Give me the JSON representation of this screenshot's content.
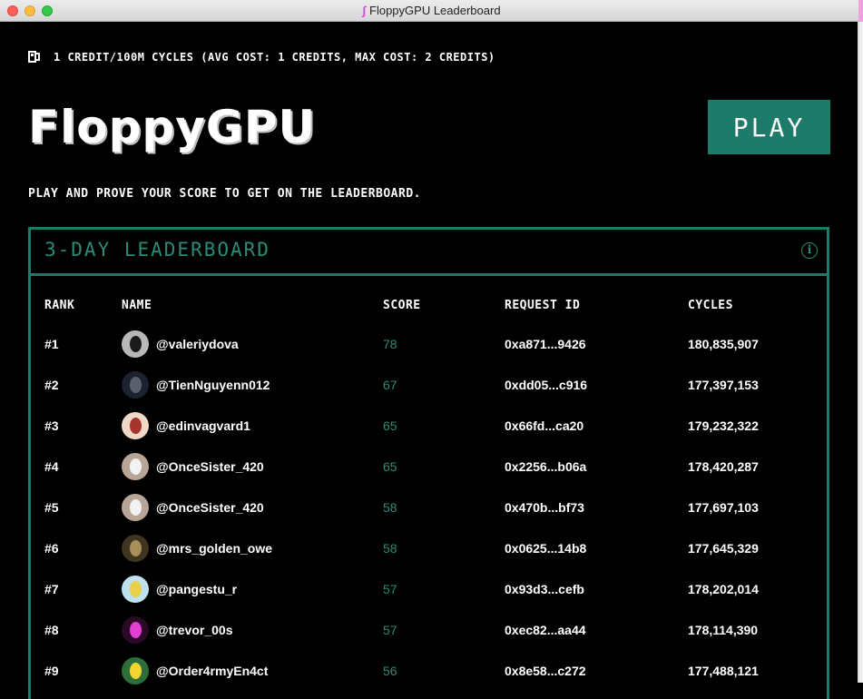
{
  "window": {
    "title": "FloppyGPU Leaderboard"
  },
  "cost": {
    "icon": "fuel-pump-icon",
    "text": "1 credit/100M cycles (avg cost: 1 credits, max cost: 2 credits)"
  },
  "hero": {
    "logo_text": "FloppyGPU",
    "play_label": "PLAY",
    "tagline": "Play and prove your score to get on the leaderboard."
  },
  "leaderboard": {
    "title": "3-Day Leaderboard",
    "info_icon": "info-icon",
    "columns": {
      "rank": "Rank",
      "name": "Name",
      "score": "Score",
      "request_id": "Request ID",
      "cycles": "Cycles"
    },
    "rows": [
      {
        "rank": "#1",
        "name": "@valeriydova",
        "score": "78",
        "request_id": "0xa871...9426",
        "cycles": "180,835,907",
        "avatar": {
          "bg": "#b8b8b8",
          "fg": "#1a1a1a"
        }
      },
      {
        "rank": "#2",
        "name": "@TienNguyenn012",
        "score": "67",
        "request_id": "0xdd05...c916",
        "cycles": "177,397,153",
        "avatar": {
          "bg": "#1d2230",
          "fg": "#5a6070"
        }
      },
      {
        "rank": "#3",
        "name": "@edinvagvard1",
        "score": "65",
        "request_id": "0x66fd...ca20",
        "cycles": "179,232,322",
        "avatar": {
          "bg": "#f0d8c8",
          "fg": "#a5342c"
        }
      },
      {
        "rank": "#4",
        "name": "@OnceSister_420",
        "score": "65",
        "request_id": "0x2256...b06a",
        "cycles": "178,420,287",
        "avatar": {
          "bg": "#b9a597",
          "fg": "#f2f2f2"
        }
      },
      {
        "rank": "#5",
        "name": "@OnceSister_420",
        "score": "58",
        "request_id": "0x470b...bf73",
        "cycles": "177,697,103",
        "avatar": {
          "bg": "#b9a597",
          "fg": "#f2f2f2"
        }
      },
      {
        "rank": "#6",
        "name": "@mrs_golden_owe",
        "score": "58",
        "request_id": "0x0625...14b8",
        "cycles": "177,645,329",
        "avatar": {
          "bg": "#3f3520",
          "fg": "#a88e5a"
        }
      },
      {
        "rank": "#7",
        "name": "@pangestu_r",
        "score": "57",
        "request_id": "0x93d3...cefb",
        "cycles": "178,202,014",
        "avatar": {
          "bg": "#bfe0ef",
          "fg": "#e8d04a"
        }
      },
      {
        "rank": "#8",
        "name": "@trevor_00s",
        "score": "57",
        "request_id": "0xec82...aa44",
        "cycles": "178,114,390",
        "avatar": {
          "bg": "#2a0a26",
          "fg": "#e23fd2"
        }
      },
      {
        "rank": "#9",
        "name": "@Order4rmyEn4ct",
        "score": "56",
        "request_id": "0x8e58...c272",
        "cycles": "177,488,121",
        "avatar": {
          "bg": "#2d6e3a",
          "fg": "#f1d630"
        }
      }
    ]
  }
}
